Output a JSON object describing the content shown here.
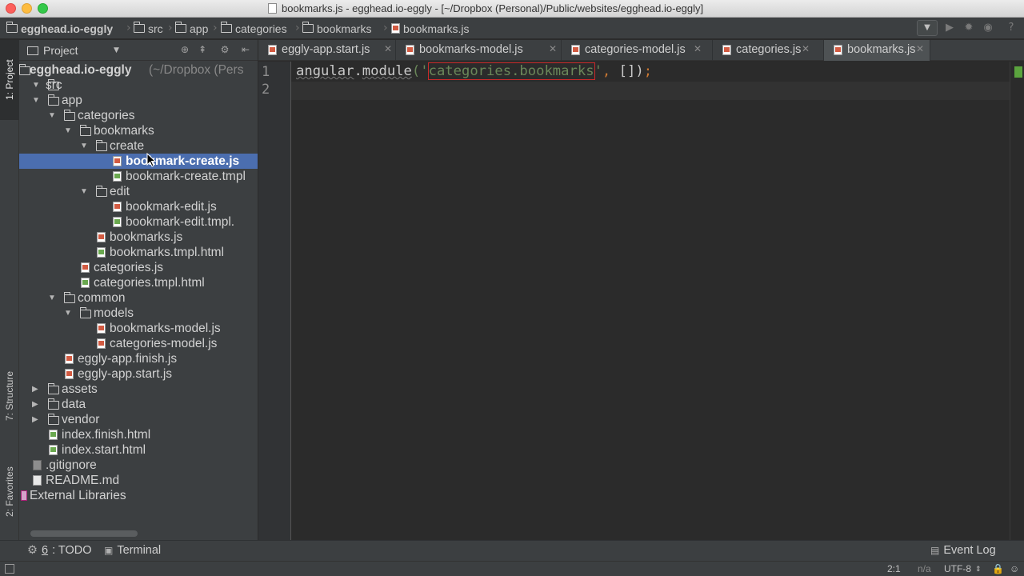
{
  "window": {
    "title": "bookmarks.js - egghead.io-eggly - [~/Dropbox (Personal)/Public/websites/egghead.io-eggly]"
  },
  "breadcrumb": [
    "egghead.io-eggly",
    "src",
    "app",
    "categories",
    "bookmarks",
    "bookmarks.js"
  ],
  "left_stripe": {
    "project_tab": "1: Project",
    "structure_tab": "7: Structure",
    "favorites_tab": "2: Favorites"
  },
  "project_panel": {
    "title": "Project",
    "root_label": "egghead.io-eggly",
    "root_hint": "(~/Dropbox (Pers",
    "items": {
      "src": "src",
      "app": "app",
      "categories": "categories",
      "bookmarks": "bookmarks",
      "create": "create",
      "bookmark_create_js": "bookmark-create.js",
      "bookmark_create_tmpl": "bookmark-create.tmpl",
      "edit": "edit",
      "bookmark_edit_js": "bookmark-edit.js",
      "bookmark_edit_tmpl": "bookmark-edit.tmpl.",
      "bookmarks_js": "bookmarks.js",
      "bookmarks_tmpl": "bookmarks.tmpl.html",
      "categories_js": "categories.js",
      "categories_tmpl": "categories.tmpl.html",
      "common": "common",
      "models": "models",
      "bookmarks_model": "bookmarks-model.js",
      "categories_model": "categories-model.js",
      "app_finish": "eggly-app.finish.js",
      "app_start": "eggly-app.start.js",
      "assets": "assets",
      "data": "data",
      "vendor": "vendor",
      "index_finish": "index.finish.html",
      "index_start": "index.start.html",
      "gitignore": ".gitignore",
      "readme": "README.md",
      "external_libs": "External Libraries"
    }
  },
  "tabs": [
    "eggly-app.start.js",
    "bookmarks-model.js",
    "categories-model.js",
    "categories.js",
    "bookmarks.js"
  ],
  "active_tab": "bookmarks.js",
  "editor": {
    "line_numbers": [
      "1",
      "2"
    ],
    "code": {
      "ident1": "angular",
      "dot": ".",
      "ident2": "module",
      "open": "('",
      "module_name": "categories.bookmarks",
      "close_quote": "'",
      "comma": ",",
      "rest": " [])",
      "semi": ";"
    }
  },
  "bottom_tools": {
    "todo_num": "6",
    "todo_label": ": TODO",
    "terminal": "Terminal",
    "event_log": "Event Log"
  },
  "status": {
    "position": "2:1",
    "na": "n/a",
    "encoding": "UTF-8"
  },
  "colors": {
    "selection": "#4b6eaf",
    "editor_bg": "#2b2b2b",
    "panel_bg": "#3c3f41",
    "string": "#6a8759",
    "error_box": "#c92a2a"
  }
}
